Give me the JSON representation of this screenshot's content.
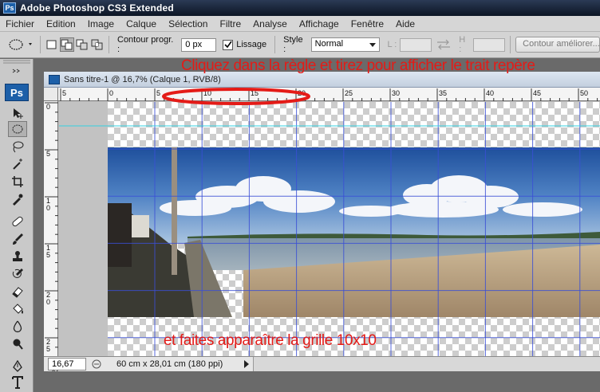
{
  "app": {
    "title": "Adobe Photoshop CS3 Extended",
    "badge": "Ps"
  },
  "menu": [
    "Fichier",
    "Edition",
    "Image",
    "Calque",
    "Sélection",
    "Filtre",
    "Analyse",
    "Affichage",
    "Fenêtre",
    "Aide"
  ],
  "options": {
    "feather_label": "Contour progr. :",
    "feather_value": "0 px",
    "antialias_label": "Lissage",
    "antialias_checked": true,
    "style_label": "Style :",
    "style_value": "Normal",
    "width_label": "L :",
    "height_label": "H :",
    "refine_label": "Contour améliorer..."
  },
  "toolbox": {
    "logo": "Ps"
  },
  "document": {
    "title": "Sans titre-1 @ 16,7% (Calque 1, RVB/8)",
    "ruler_top_labels": [
      "5",
      "0",
      "5",
      "10",
      "15",
      "20",
      "25",
      "30",
      "35",
      "40",
      "45",
      "50"
    ],
    "ruler_left_labels": [
      "0",
      "5",
      "1\n0",
      "1\n5",
      "2\n0",
      "2\n5"
    ]
  },
  "status": {
    "zoom": "16,67 %",
    "info": "60 cm x 28,01 cm (180 ppi)"
  },
  "annotations": {
    "top": "Cliquez dans la règle et tirez pour afficher le trait repère",
    "bottom": "et faites apparaître la grille 10x10"
  },
  "colors": {
    "annotation": "#e41b17",
    "grid": "#3a4fd6",
    "guide": "#35d0e0"
  }
}
